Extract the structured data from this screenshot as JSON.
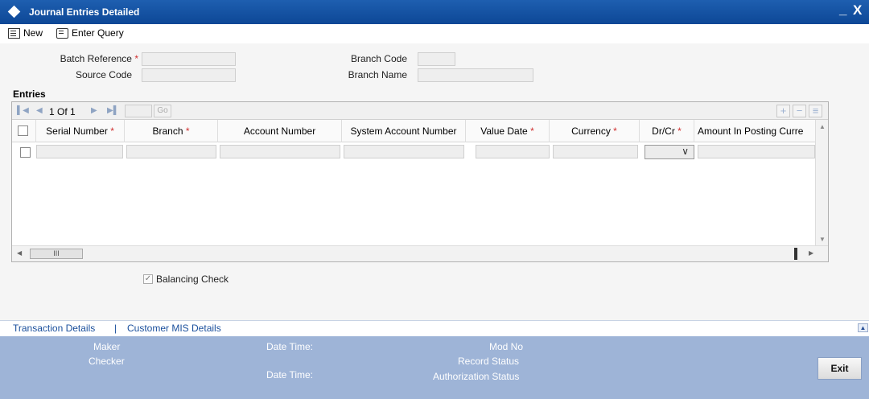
{
  "window": {
    "title": "Journal Entries Detailed",
    "minimize": "_",
    "close": "X"
  },
  "toolbar": {
    "new_label": "New",
    "enter_query_label": "Enter Query"
  },
  "form": {
    "batch_reference_label": "Batch Reference",
    "source_code_label": "Source Code",
    "branch_code_label": "Branch Code",
    "branch_name_label": "Branch Name",
    "required_marker": "*"
  },
  "entries": {
    "title": "Entries",
    "pagination": "1 Of 1",
    "go_label": "Go",
    "columns": [
      {
        "label": "Serial Number",
        "required": true
      },
      {
        "label": "Branch",
        "required": true
      },
      {
        "label": "Account Number",
        "required": false
      },
      {
        "label": "System Account Number",
        "required": false
      },
      {
        "label": "Value Date",
        "required": true
      },
      {
        "label": "Currency",
        "required": true
      },
      {
        "label": "Dr/Cr",
        "required": true
      },
      {
        "label": "Amount In Posting Curre",
        "required": false
      }
    ],
    "scroll_thumb_text": "III"
  },
  "balancing_check": {
    "label": "Balancing Check",
    "checked": true
  },
  "links": {
    "transaction_details": "Transaction Details",
    "separator": "|",
    "customer_mis_details": "Customer MIS Details"
  },
  "footer": {
    "maker_label": "Maker",
    "checker_label": "Checker",
    "date_time_label_1": "Date Time:",
    "date_time_label_2": "Date Time:",
    "mod_no_label": "Mod No",
    "record_status_label": "Record Status",
    "authorization_status_label": "Authorization Status",
    "exit_label": "Exit"
  },
  "colors": {
    "title_bar": "#1e5fb0",
    "footer": "#9eb4d7",
    "link": "#1a4f9c",
    "required": "#d03030"
  }
}
